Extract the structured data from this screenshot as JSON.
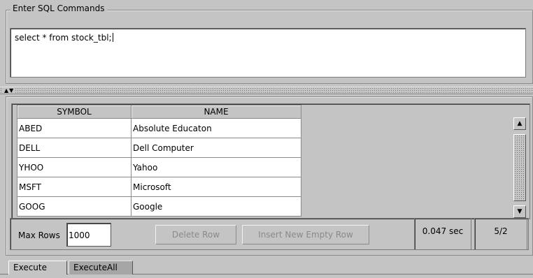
{
  "sql_panel": {
    "legend": "Enter SQL Commands",
    "query": "select * from stock_tbl;"
  },
  "results": {
    "columns": [
      "SYMBOL",
      "NAME"
    ],
    "rows": [
      [
        "ABED",
        "Absolute Educaton"
      ],
      [
        "DELL",
        "Dell Computer"
      ],
      [
        "YHOO",
        "Yahoo"
      ],
      [
        "MSFT",
        "Microsoft"
      ],
      [
        "GOOG",
        "Google"
      ]
    ]
  },
  "controls": {
    "max_rows_label": "Max Rows",
    "max_rows_value": "1000",
    "delete_row_label": "Delete Row",
    "insert_row_label": "Insert New Empty Row",
    "elapsed": "0.047 sec",
    "row_count": "5/2"
  },
  "tabs": [
    {
      "label": "Execute",
      "selected": true
    },
    {
      "label": "ExecuteAll",
      "selected": false
    }
  ],
  "icons": {
    "scroll_up": "scroll-up-arrow-icon",
    "scroll_down": "scroll-down-arrow-icon",
    "splitter": "splitter-arrows-icon"
  }
}
